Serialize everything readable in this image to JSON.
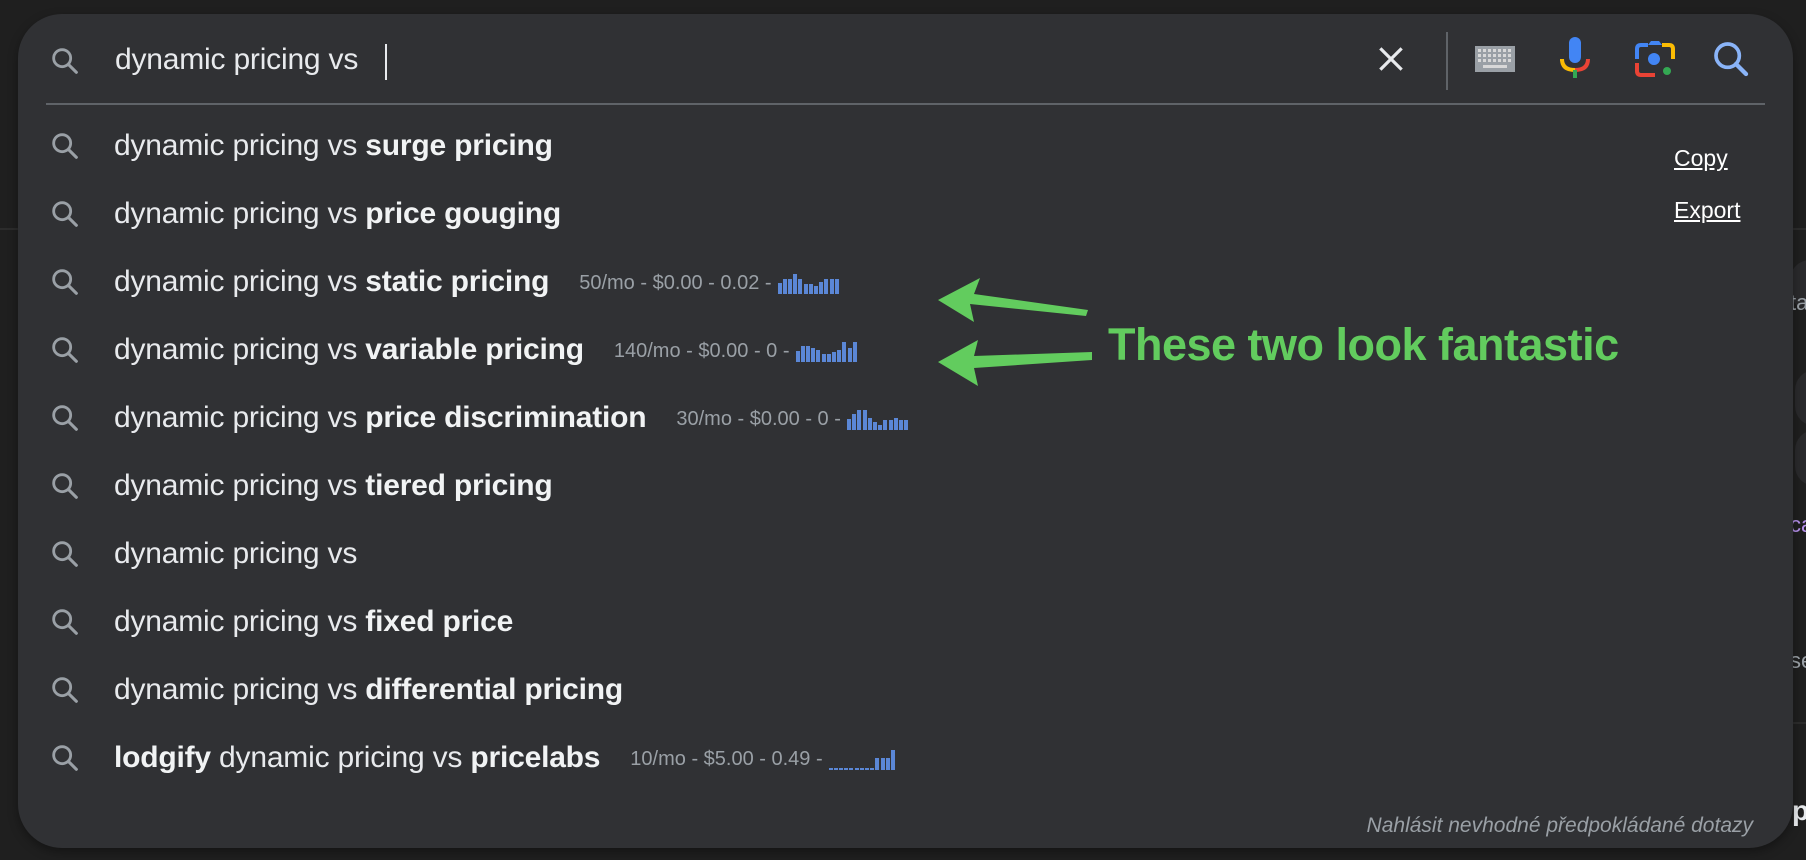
{
  "search": {
    "query": "dynamic pricing vs ",
    "placeholder": ""
  },
  "toolbar": {
    "clear_icon": "close-icon",
    "keyboard_icon": "keyboard-icon",
    "voice_icon": "microphone-icon",
    "lens_icon": "camera-lens-icon",
    "search_icon": "search-icon"
  },
  "suggestions": [
    {
      "prefix": "dynamic pricing vs ",
      "bold": "surge pricing",
      "pre_bold": "",
      "meta": null
    },
    {
      "prefix": "dynamic pricing vs ",
      "bold": "price gouging",
      "pre_bold": "",
      "meta": null
    },
    {
      "prefix": "dynamic pricing vs ",
      "bold": "static pricing",
      "pre_bold": "",
      "meta": {
        "text": "50/mo - $0.00 - 0.02 -",
        "volume": "50/mo",
        "cpc": "$0.00",
        "competition": "0.02",
        "trend": [
          0.55,
          0.75,
          0.75,
          1.0,
          0.75,
          0.5,
          0.5,
          0.4,
          0.6,
          0.75,
          0.75,
          0.75
        ]
      }
    },
    {
      "prefix": "dynamic pricing vs ",
      "bold": "variable pricing",
      "pre_bold": "",
      "meta": {
        "text": "140/mo - $0.00 - 0 -",
        "volume": "140/mo",
        "cpc": "$0.00",
        "competition": "0",
        "trend": [
          0.55,
          0.8,
          0.8,
          0.7,
          0.6,
          0.4,
          0.4,
          0.5,
          0.6,
          1.0,
          0.7,
          1.0
        ]
      }
    },
    {
      "prefix": "dynamic pricing vs ",
      "bold": "price discrimination",
      "pre_bold": "",
      "meta": {
        "text": "30/mo - $0.00 - 0 -",
        "volume": "30/mo",
        "cpc": "$0.00",
        "competition": "0",
        "trend": [
          0.55,
          0.8,
          1.0,
          1.0,
          0.6,
          0.4,
          0.25,
          0.5,
          0.5,
          0.6,
          0.5,
          0.5
        ]
      }
    },
    {
      "prefix": "dynamic pricing vs ",
      "bold": "tiered pricing",
      "pre_bold": "",
      "meta": null
    },
    {
      "prefix": "dynamic pricing vs",
      "bold": "",
      "pre_bold": "",
      "meta": null
    },
    {
      "prefix": "dynamic pricing vs ",
      "bold": "fixed price",
      "pre_bold": "",
      "meta": null
    },
    {
      "prefix": "dynamic pricing vs ",
      "bold": "differential pricing",
      "pre_bold": "",
      "meta": null
    },
    {
      "prefix": " dynamic pricing vs ",
      "bold": "pricelabs",
      "pre_bold": "lodgify",
      "meta": {
        "text": "10/mo - $5.00 - 0.49 -",
        "volume": "10/mo",
        "cpc": "$5.00",
        "competition": "0.49",
        "trend": [
          0.1,
          0.1,
          0.1,
          0.1,
          0.1,
          0.1,
          0.1,
          0.1,
          0.1,
          0.6,
          0.6,
          0.6,
          1.0
        ]
      }
    }
  ],
  "side_links": {
    "copy": "Copy",
    "export": "Export"
  },
  "footer": {
    "report": "Nahlásit nevhodné předpokládané dotazy"
  },
  "annotation": {
    "text": "These two look fantastic",
    "color": "#62cc5e"
  },
  "colors": {
    "panel": "#303134",
    "text": "#e8eaed",
    "meta": "#9aa0a6",
    "sparkline": "#5b87d6",
    "google_blue": "#4285f4",
    "google_red": "#ea4335",
    "google_yellow": "#fbbc04",
    "google_green": "#34a853"
  },
  "background_fragments": [
    "ta",
    "ca",
    "se",
    "p"
  ]
}
